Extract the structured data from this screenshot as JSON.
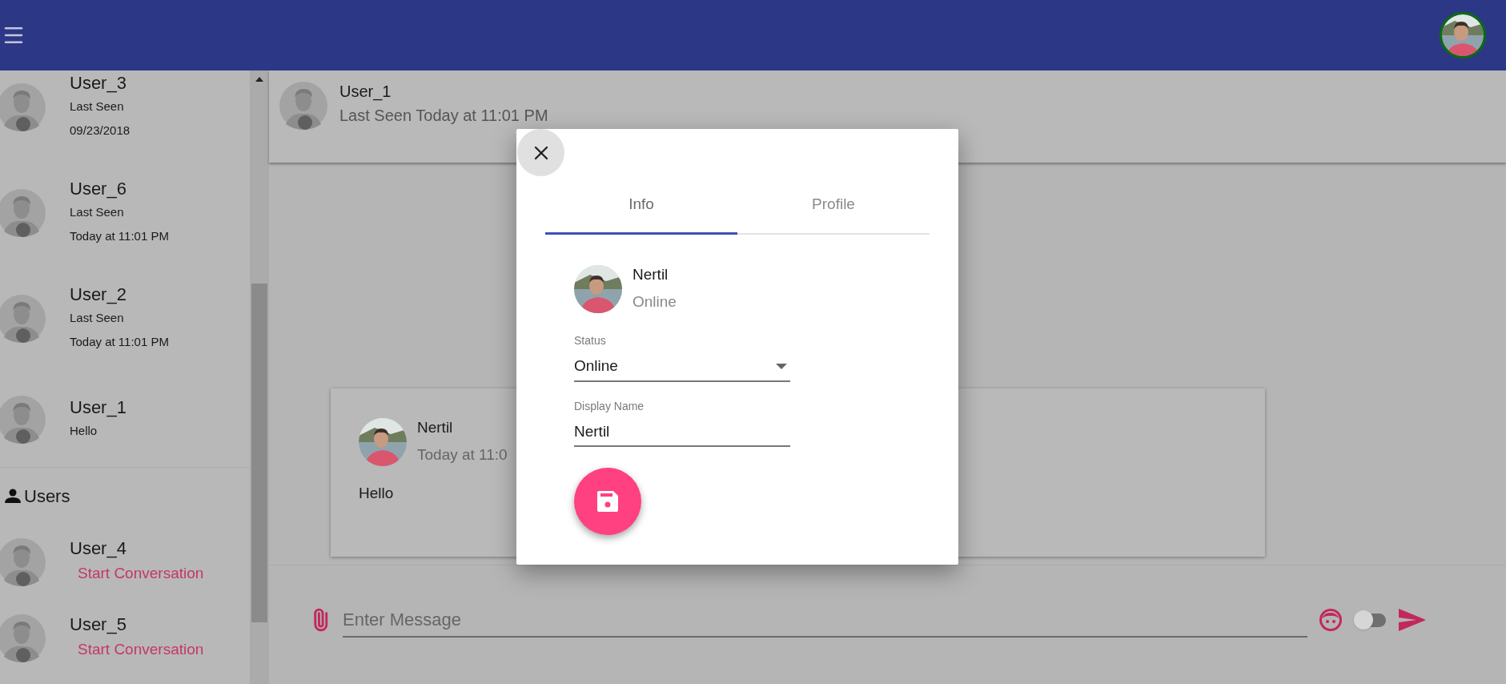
{
  "sidebar": {
    "conversations": [
      {
        "name": "User_3",
        "lines": [
          "Last Seen",
          "09/23/2018"
        ]
      },
      {
        "name": "User_6",
        "lines": [
          "Last Seen",
          "Today at 11:01 PM"
        ]
      },
      {
        "name": "User_2",
        "lines": [
          "Last Seen",
          "Today at 11:01 PM"
        ]
      },
      {
        "name": "User_1",
        "lines": [
          "Hello"
        ]
      }
    ],
    "users_heading": "Users",
    "users": [
      {
        "name": "User_4",
        "action": "Start Conversation"
      },
      {
        "name": "User_5",
        "action": "Start Conversation"
      }
    ]
  },
  "chat_header": {
    "name": "User_1",
    "last_seen": "Last Seen Today at 11:01 PM"
  },
  "messages": [
    {
      "sender": "Nertil",
      "time": "Today at 11:0",
      "text": "Hello"
    }
  ],
  "composer": {
    "placeholder": "Enter Message",
    "toggle_on": false
  },
  "dialog": {
    "tabs": [
      {
        "label": "Info",
        "selected": true
      },
      {
        "label": "Profile",
        "selected": false
      }
    ],
    "profile": {
      "name": "Nertil",
      "status": "Online"
    },
    "status_field": {
      "label": "Status",
      "value": "Online"
    },
    "display_name_field": {
      "label": "Display Name",
      "value": "Nertil"
    }
  }
}
